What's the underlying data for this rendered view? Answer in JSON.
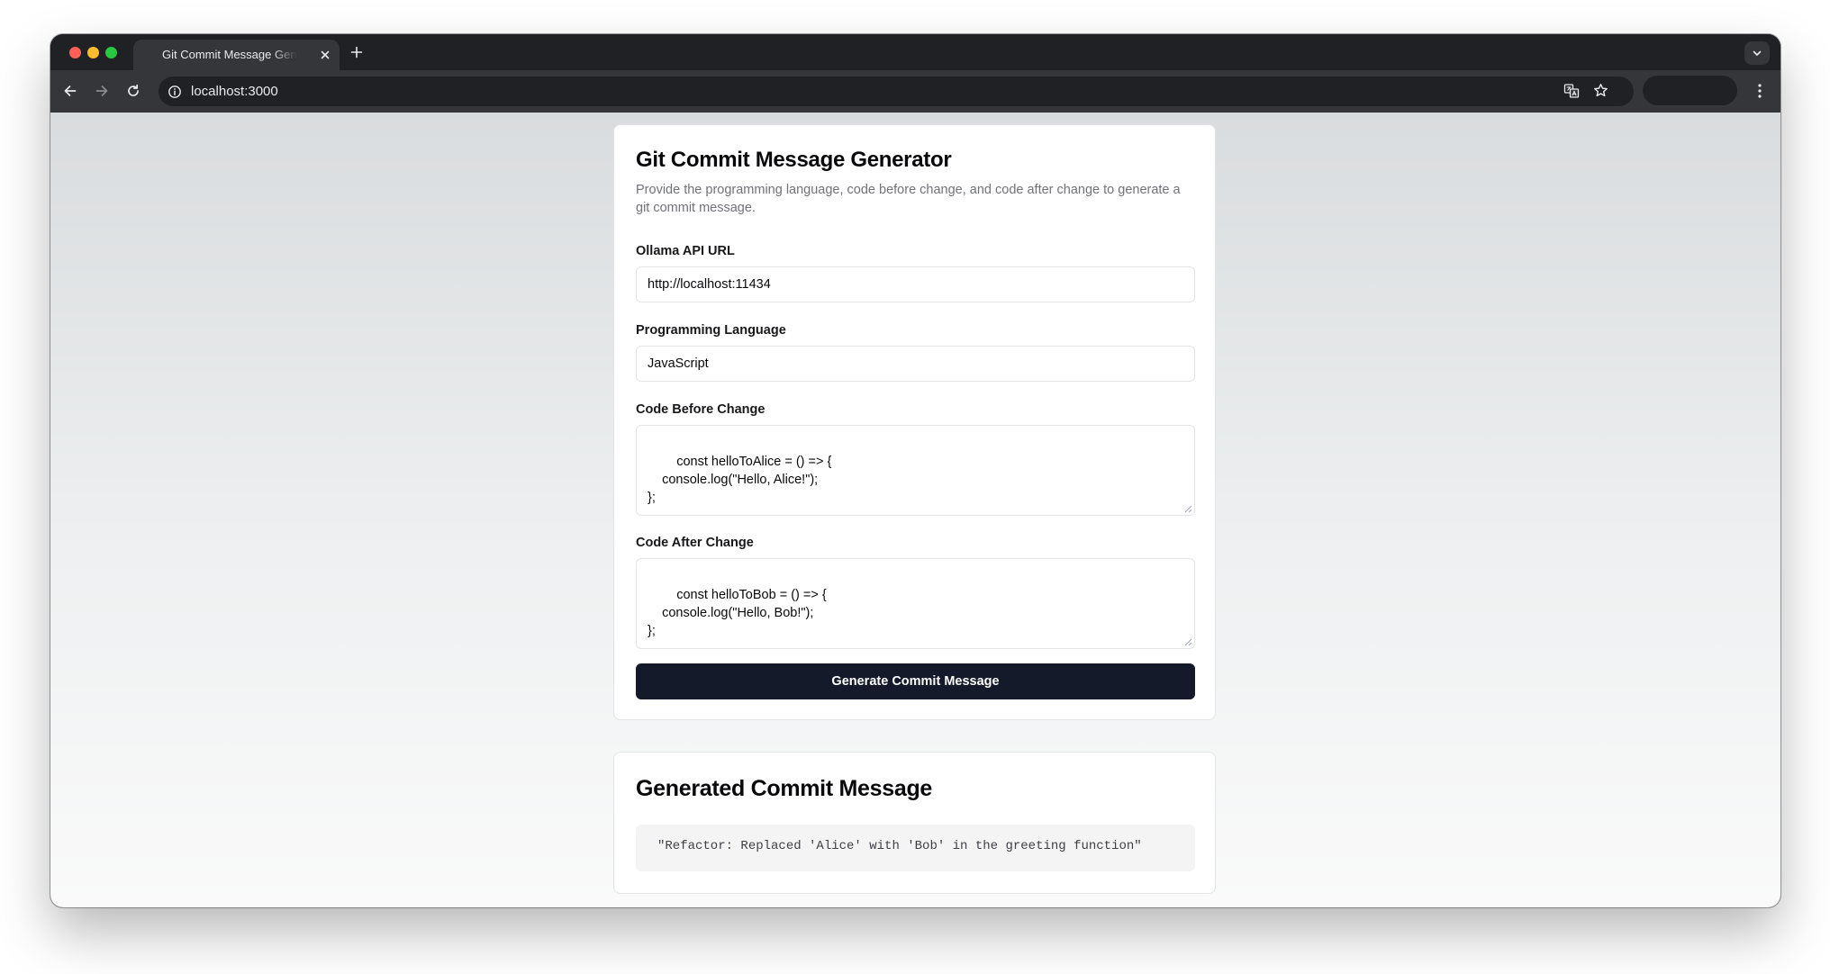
{
  "browser": {
    "tab_title": "Git Commit Message Generator",
    "url": "localhost:3000"
  },
  "form": {
    "title": "Git Commit Message Generator",
    "description": "Provide the programming language, code before change, and code after change to generate a git commit message.",
    "api_url_label": "Ollama API URL",
    "api_url_value": "http://localhost:11434",
    "language_label": "Programming Language",
    "language_value": "JavaScript",
    "code_before_label": "Code Before Change",
    "code_before_value": "const helloToAlice = () => {\n    console.log(\"Hello, Alice!\");\n};",
    "code_after_label": "Code After Change",
    "code_after_value": "const helloToBob = () => {\n    console.log(\"Hello, Bob!\");\n};",
    "submit_label": "Generate Commit Message"
  },
  "result": {
    "title": "Generated Commit Message",
    "message": "\"Refactor: Replaced 'Alice' with 'Bob' in the greeting function\""
  },
  "icons": {
    "tab_close": "close-icon",
    "new_tab": "plus-icon",
    "tab_search": "chevron-down-icon",
    "back": "arrow-left-icon",
    "forward": "arrow-right-icon",
    "reload": "reload-icon",
    "site_info": "info-icon",
    "translate": "translate-icon",
    "bookmark": "star-icon",
    "menu": "kebab-menu-icon"
  },
  "colors": {
    "button_bg": "#141a29",
    "window_chrome": "#202124",
    "toolbar": "#35363a"
  }
}
